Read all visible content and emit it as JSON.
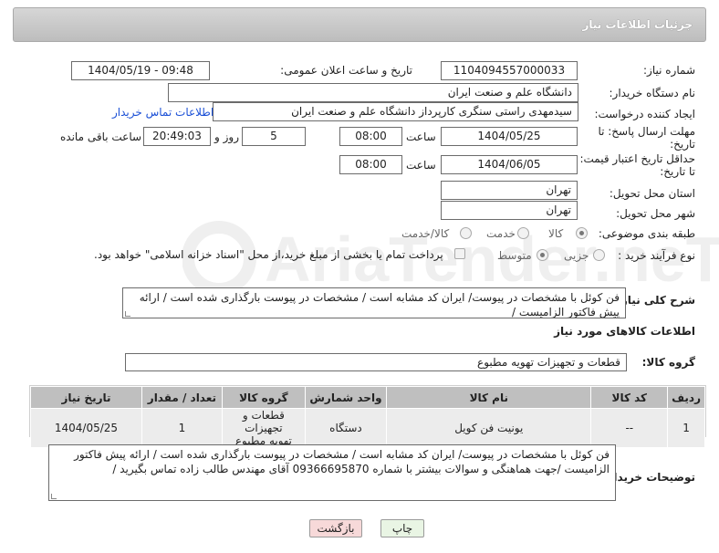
{
  "header": {
    "title": "جزئیات اطلاعات نیاز"
  },
  "fields": {
    "need_number": {
      "label": "شماره نیاز:",
      "value": "1104094557000033"
    },
    "announce_datetime": {
      "label": "تاریخ و ساعت اعلان عمومی:",
      "value": "1404/05/19 - 09:48"
    },
    "buyer_org": {
      "label": "نام دستگاه خریدار:",
      "value": "دانشگاه علم و صنعت ایران"
    },
    "requester": {
      "label": "ایجاد کننده درخواست:",
      "value": "سیدمهدی راستی سنگری کارپرداز دانشگاه علم و صنعت ایران",
      "link": "اطلاعات تماس خریدار"
    },
    "reply_deadline": {
      "label_line1": "مهلت ارسال پاسخ: تا",
      "label_line2": "تاریخ:",
      "date": "1404/05/25",
      "time_label": "ساعت",
      "time": "08:00",
      "days": "5",
      "days_label": "روز و",
      "remaining": "20:49:03",
      "remaining_label": "ساعت باقی مانده"
    },
    "price_validity": {
      "label_line1": "حداقل تاریخ اعتبار قیمت:",
      "label_line2": "تا تاریخ:",
      "date": "1404/06/05",
      "time_label": "ساعت",
      "time": "08:00"
    },
    "delivery_province": {
      "label": "استان محل تحویل:",
      "value": "تهران"
    },
    "delivery_city": {
      "label": "شهر محل تحویل:",
      "value": "تهران"
    },
    "category": {
      "label": "طبقه بندی موضوعی:",
      "options": [
        "کالا",
        "خدمت",
        "کالا/خدمت"
      ],
      "selected": "کالا"
    },
    "purchase_type": {
      "label": "نوع فرآیند خرید :",
      "options": [
        "جزیی",
        "متوسط"
      ],
      "selected": "متوسط",
      "payment_note": "پرداخت تمام یا بخشی از مبلغ خرید،از محل \"اسناد خزانه اسلامی\" خواهد بود."
    }
  },
  "description": {
    "label": "شرح کلی نیاز:",
    "value": "فن کوئل با مشخصات در پیوست/ ایران کد مشابه است / مشخصات در پیوست بارگذاری شده است / ارائه پیش فاکتور الزامیست /"
  },
  "goods_section": {
    "title": "اطلاعات کالاهای مورد نیاز",
    "group_label": "گروه کالا:",
    "group_value": "قطعات و تجهیزات تهویه مطبوع"
  },
  "table": {
    "headers": [
      "ردیف",
      "کد کالا",
      "نام کالا",
      "واحد شمارش",
      "گروه کالا",
      "تعداد / مقدار",
      "تاریخ نیاز"
    ],
    "rows": [
      {
        "row": "1",
        "code": "--",
        "name": "یونیت فن کویل",
        "unit": "دستگاه",
        "group_line1": "قطعات و تجهیزات",
        "group_line2": "تهویه مطبوع",
        "qty": "1",
        "date": "1404/05/25"
      }
    ]
  },
  "buyer_notes": {
    "label": "توضیحات خریدار:",
    "value": "فن کوئل با مشخصات در پیوست/ ایران کد مشابه است / مشخصات در پیوست بارگذاری شده است / ارائه پیش فاکتور الزامیست /جهت هماهنگی و سوالات بیشتر با شماره 09366695870 آقای مهندس طالب زاده تماس بگیرید /"
  },
  "buttons": {
    "print": "چاپ",
    "back": "بازگشت"
  },
  "watermark": {
    "text": "AriaTender.neT"
  },
  "colors": {
    "link": "#1a4fd6",
    "back_button_bg": "#f7d9d9",
    "print_button_bg": "#e9f5e4"
  }
}
